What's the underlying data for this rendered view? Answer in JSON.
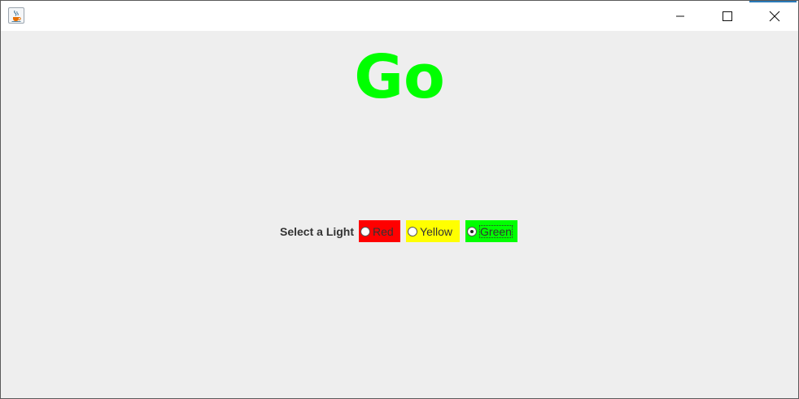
{
  "window": {
    "app_icon": "java-coffee-cup-icon",
    "controls": [
      {
        "name": "minimize-icon",
        "glyph": "minimize"
      },
      {
        "name": "maximize-icon",
        "glyph": "maximize"
      },
      {
        "name": "close-icon",
        "glyph": "close"
      }
    ]
  },
  "main": {
    "status_text": "Go",
    "status_color": "#00ff00",
    "selector": {
      "label": "Select a Light",
      "options": [
        {
          "label": "Red",
          "color": "#ff0000",
          "checked": false
        },
        {
          "label": "Yellow",
          "color": "#ffff00",
          "checked": false
        },
        {
          "label": "Green",
          "color": "#00ff00",
          "checked": true
        }
      ]
    }
  }
}
